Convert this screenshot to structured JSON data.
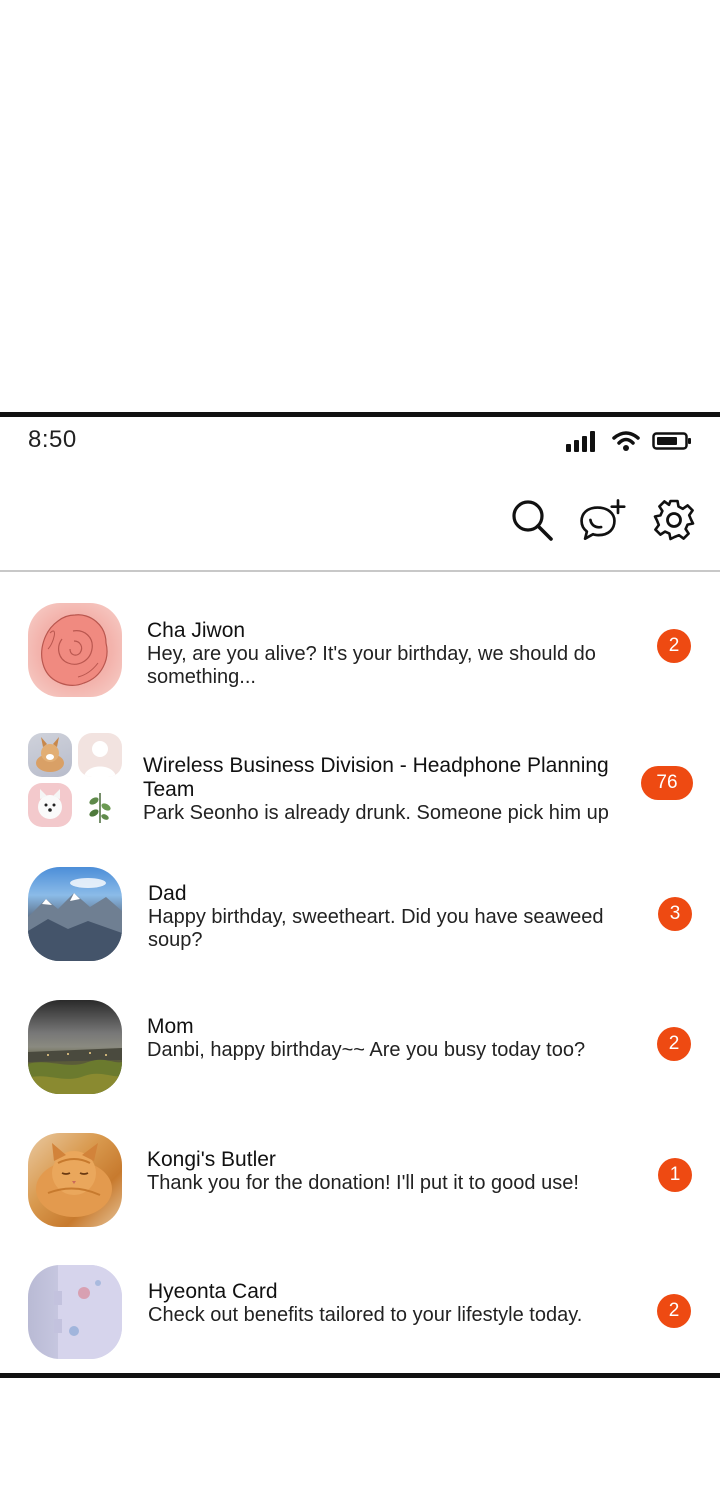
{
  "status_bar": {
    "time": "8:50"
  },
  "toolbar": {
    "icons": [
      "search-icon",
      "new-chat-icon",
      "gear-icon"
    ]
  },
  "chats": [
    {
      "name": "Cha Jiwon",
      "message": "Hey, are you alive? It's your birthday, we should do something...",
      "unread": "2"
    },
    {
      "name": "Wireless Business Division - Headphone Planning Team",
      "message": "Park Seonho is already drunk. Someone pick him up",
      "unread": "76"
    },
    {
      "name": "Dad",
      "message": "Happy birthday, sweetheart. Did you have seaweed soup?",
      "unread": "3"
    },
    {
      "name": "Mom",
      "message": "Danbi, happy birthday~~ Are you busy today too?",
      "unread": "2"
    },
    {
      "name": "Kongi's Butler",
      "message": "Thank you for the donation! I'll put it to good use!",
      "unread": "1"
    },
    {
      "name": "Hyeonta Card",
      "message": "Check out benefits tailored to your lifestyle today.",
      "unread": "2"
    }
  ],
  "colors": {
    "badge": "#ee4a12",
    "divider": "#c8c8c8",
    "frame": "#111111"
  }
}
